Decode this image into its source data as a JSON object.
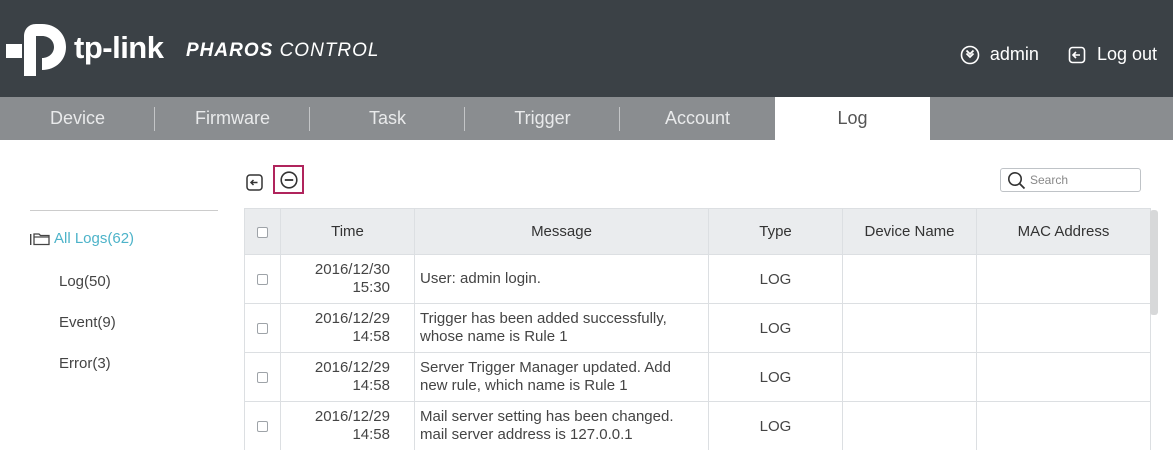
{
  "header": {
    "brand": "tp-link",
    "product_bold": "PHAROS",
    "product_light": "CONTROL",
    "user_label": "admin",
    "logout_label": "Log out",
    "colors": {
      "bar": "#3b4146",
      "accent": "#4db3c9",
      "highlight": "#b0245c"
    }
  },
  "tabs": [
    {
      "label": "Device"
    },
    {
      "label": "Firmware"
    },
    {
      "label": "Task"
    },
    {
      "label": "Trigger"
    },
    {
      "label": "Account"
    },
    {
      "label": "Log",
      "active": true
    }
  ],
  "sidebar": {
    "items": [
      {
        "label": "All Logs(62)",
        "active": true
      },
      {
        "label": "Log(50)"
      },
      {
        "label": "Event(9)"
      },
      {
        "label": "Error(3)"
      }
    ]
  },
  "toolbar": {
    "export_icon": "export-icon",
    "delete_icon": "minus-circle-icon",
    "search_placeholder": "Search"
  },
  "table": {
    "headers": {
      "time": "Time",
      "message": "Message",
      "type": "Type",
      "device": "Device Name",
      "mac": "MAC Address"
    },
    "rows": [
      {
        "date": "2016/12/30",
        "clock": "15:30",
        "msg1": "User: admin login.",
        "msg2": "",
        "type": "LOG",
        "device": "",
        "mac": ""
      },
      {
        "date": "2016/12/29",
        "clock": "14:58",
        "msg1": "Trigger has been added successfully,",
        "msg2": "whose name is Rule 1",
        "type": "LOG",
        "device": "",
        "mac": ""
      },
      {
        "date": "2016/12/29",
        "clock": "14:58",
        "msg1": "Server Trigger Manager updated. Add",
        "msg2": "new rule, which name is Rule 1",
        "type": "LOG",
        "device": "",
        "mac": ""
      },
      {
        "date": "2016/12/29",
        "clock": "14:58",
        "msg1": "Mail server setting has been changed.",
        "msg2": "mail server address is 127.0.0.1",
        "type": "LOG",
        "device": "",
        "mac": ""
      }
    ]
  }
}
